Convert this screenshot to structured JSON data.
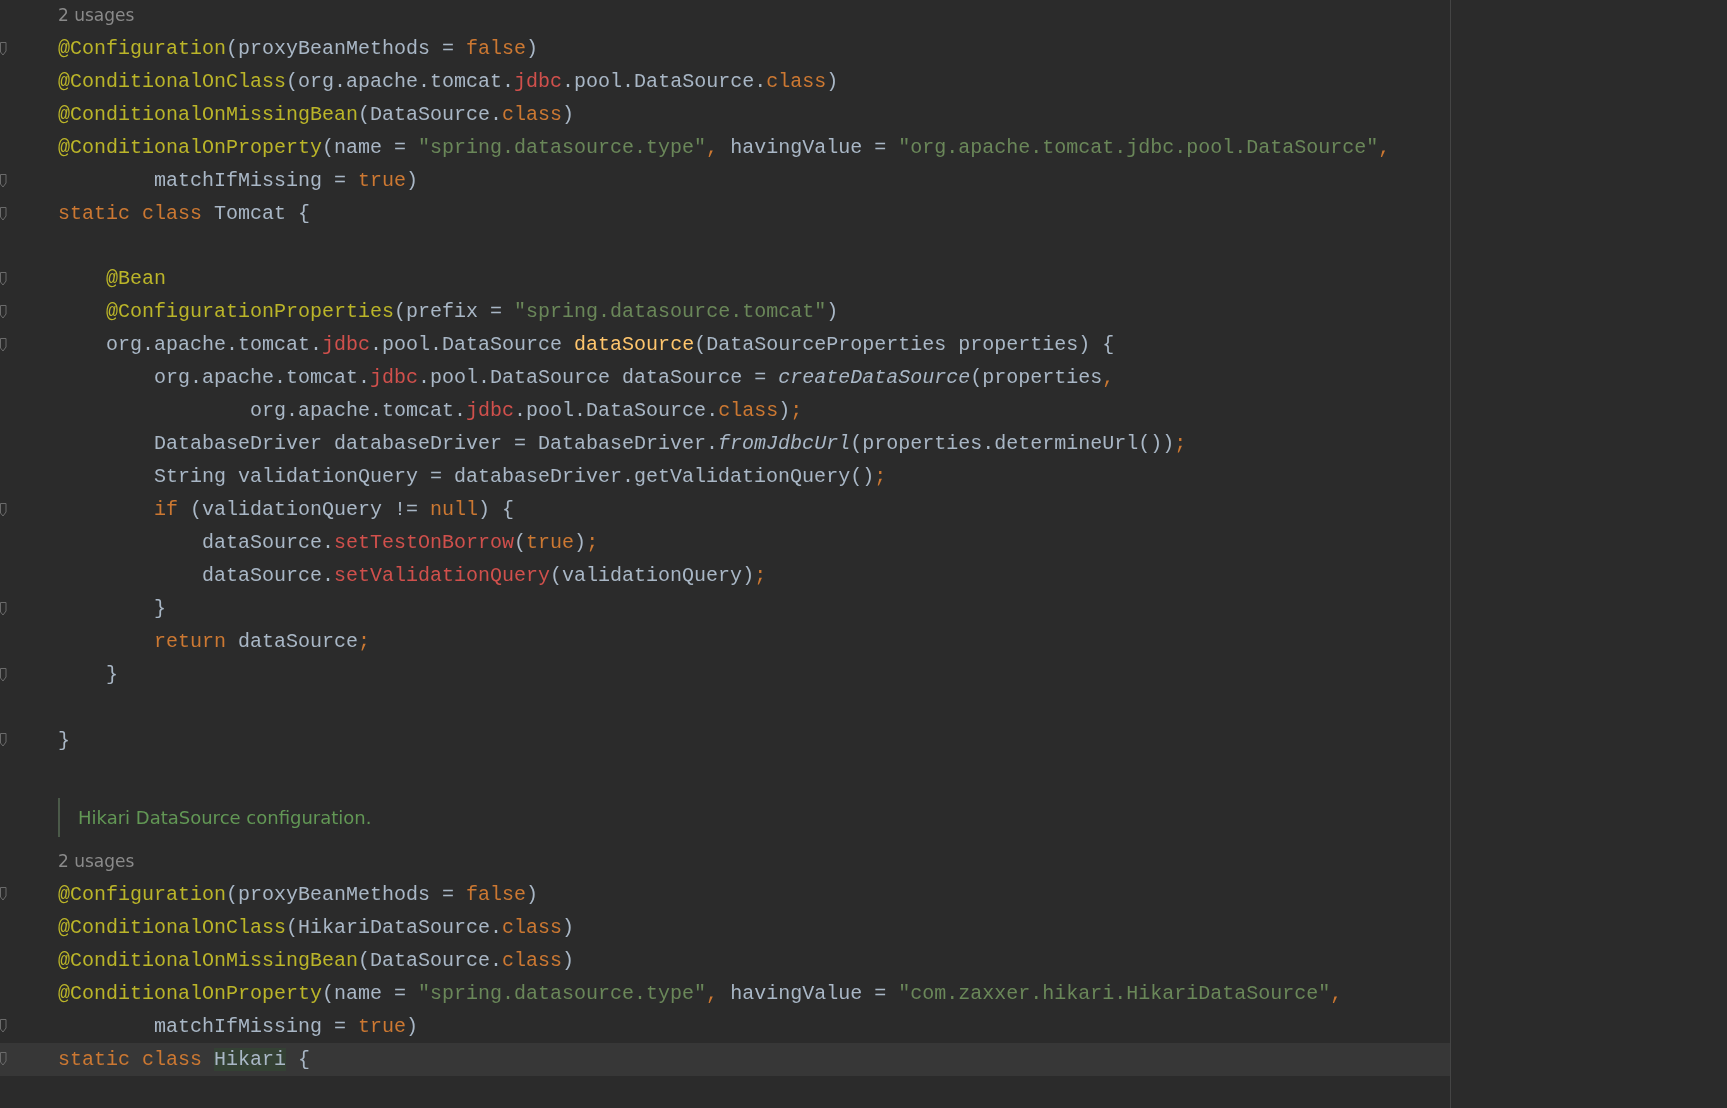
{
  "editor": {
    "lines": [
      {
        "kind": "usages",
        "text": "2 usages"
      },
      {
        "kind": "code",
        "fold": true,
        "current": false,
        "tokens": [
          {
            "t": "@Configuration",
            "kind": "annotation"
          },
          {
            "t": "(proxyBeanMethods = ",
            "kind": "plain"
          },
          {
            "t": "false",
            "kind": "keyword"
          },
          {
            "t": ")",
            "kind": "plain"
          }
        ]
      },
      {
        "kind": "code",
        "fold": false,
        "current": false,
        "tokens": [
          {
            "t": "@ConditionalOnClass",
            "kind": "annotation"
          },
          {
            "t": "(org.apache.tomcat.",
            "kind": "plain"
          },
          {
            "t": "jdbc",
            "kind": "error"
          },
          {
            "t": ".pool.DataSource.",
            "kind": "plain"
          },
          {
            "t": "class",
            "kind": "keyword"
          },
          {
            "t": ")",
            "kind": "plain"
          }
        ]
      },
      {
        "kind": "code",
        "fold": false,
        "current": false,
        "tokens": [
          {
            "t": "@ConditionalOnMissingBean",
            "kind": "annotation"
          },
          {
            "t": "(DataSource.",
            "kind": "plain"
          },
          {
            "t": "class",
            "kind": "keyword"
          },
          {
            "t": ")",
            "kind": "plain"
          }
        ]
      },
      {
        "kind": "code",
        "fold": false,
        "current": false,
        "tokens": [
          {
            "t": "@ConditionalOnProperty",
            "kind": "annotation"
          },
          {
            "t": "(name = ",
            "kind": "plain"
          },
          {
            "t": "\"spring.datasource.type\"",
            "kind": "string"
          },
          {
            "t": ", ",
            "kind": "keyword"
          },
          {
            "t": "havingValue = ",
            "kind": "plain"
          },
          {
            "t": "\"org.apache.tomcat.jdbc.pool.DataSource\"",
            "kind": "string"
          },
          {
            "t": ",",
            "kind": "keyword"
          }
        ]
      },
      {
        "kind": "code",
        "fold": true,
        "current": false,
        "tokens": [
          {
            "t": "        matchIfMissing = ",
            "kind": "plain"
          },
          {
            "t": "true",
            "kind": "keyword"
          },
          {
            "t": ")",
            "kind": "plain"
          }
        ]
      },
      {
        "kind": "code",
        "fold": true,
        "current": false,
        "tokens": [
          {
            "t": "static class ",
            "kind": "keyword"
          },
          {
            "t": "Tomcat {",
            "kind": "plain"
          }
        ]
      },
      {
        "kind": "blank"
      },
      {
        "kind": "code",
        "fold": true,
        "current": false,
        "tokens": [
          {
            "t": "    @Bean",
            "kind": "annotation"
          }
        ]
      },
      {
        "kind": "code",
        "fold": true,
        "current": false,
        "tokens": [
          {
            "t": "    @ConfigurationProperties",
            "kind": "annotation"
          },
          {
            "t": "(prefix = ",
            "kind": "plain"
          },
          {
            "t": "\"spring.datasource.tomcat\"",
            "kind": "string"
          },
          {
            "t": ")",
            "kind": "plain"
          }
        ]
      },
      {
        "kind": "code",
        "fold": true,
        "current": false,
        "tokens": [
          {
            "t": "    org.apache.tomcat.",
            "kind": "plain"
          },
          {
            "t": "jdbc",
            "kind": "error"
          },
          {
            "t": ".pool.DataSource ",
            "kind": "plain"
          },
          {
            "t": "dataSource",
            "kind": "method"
          },
          {
            "t": "(DataSourceProperties properties) {",
            "kind": "plain"
          }
        ]
      },
      {
        "kind": "code",
        "fold": false,
        "current": false,
        "tokens": [
          {
            "t": "        org.apache.tomcat.",
            "kind": "plain"
          },
          {
            "t": "jdbc",
            "kind": "error"
          },
          {
            "t": ".pool.DataSource dataSource = ",
            "kind": "plain"
          },
          {
            "t": "createDataSource",
            "kind": "static"
          },
          {
            "t": "(properties",
            "kind": "plain"
          },
          {
            "t": ",",
            "kind": "keyword"
          }
        ]
      },
      {
        "kind": "code",
        "fold": false,
        "current": false,
        "tokens": [
          {
            "t": "                org.apache.tomcat.",
            "kind": "plain"
          },
          {
            "t": "jdbc",
            "kind": "error"
          },
          {
            "t": ".pool.DataSource.",
            "kind": "plain"
          },
          {
            "t": "class",
            "kind": "keyword"
          },
          {
            "t": ")",
            "kind": "plain"
          },
          {
            "t": ";",
            "kind": "keyword"
          }
        ]
      },
      {
        "kind": "code",
        "fold": false,
        "current": false,
        "tokens": [
          {
            "t": "        DatabaseDriver databaseDriver = DatabaseDriver.",
            "kind": "plain"
          },
          {
            "t": "fromJdbcUrl",
            "kind": "static"
          },
          {
            "t": "(properties.determineUrl())",
            "kind": "plain"
          },
          {
            "t": ";",
            "kind": "keyword"
          }
        ]
      },
      {
        "kind": "code",
        "fold": false,
        "current": false,
        "tokens": [
          {
            "t": "        String validationQuery = databaseDriver.getValidationQuery()",
            "kind": "plain"
          },
          {
            "t": ";",
            "kind": "keyword"
          }
        ]
      },
      {
        "kind": "code",
        "fold": true,
        "current": false,
        "tokens": [
          {
            "t": "        if",
            "kind": "keyword"
          },
          {
            "t": " (validationQuery != ",
            "kind": "plain"
          },
          {
            "t": "null",
            "kind": "keyword"
          },
          {
            "t": ") {",
            "kind": "plain"
          }
        ]
      },
      {
        "kind": "code",
        "fold": false,
        "current": false,
        "tokens": [
          {
            "t": "            dataSource.",
            "kind": "plain"
          },
          {
            "t": "setTestOnBorrow",
            "kind": "error"
          },
          {
            "t": "(",
            "kind": "plain"
          },
          {
            "t": "true",
            "kind": "keyword"
          },
          {
            "t": ")",
            "kind": "plain"
          },
          {
            "t": ";",
            "kind": "keyword"
          }
        ]
      },
      {
        "kind": "code",
        "fold": false,
        "current": false,
        "tokens": [
          {
            "t": "            dataSource.",
            "kind": "plain"
          },
          {
            "t": "setValidationQuery",
            "kind": "error"
          },
          {
            "t": "(validationQuery)",
            "kind": "plain"
          },
          {
            "t": ";",
            "kind": "keyword"
          }
        ]
      },
      {
        "kind": "code",
        "fold": true,
        "current": false,
        "tokens": [
          {
            "t": "        }",
            "kind": "plain"
          }
        ]
      },
      {
        "kind": "code",
        "fold": false,
        "current": false,
        "tokens": [
          {
            "t": "        return",
            "kind": "keyword"
          },
          {
            "t": " dataSource",
            "kind": "plain"
          },
          {
            "t": ";",
            "kind": "keyword"
          }
        ]
      },
      {
        "kind": "code",
        "fold": true,
        "current": false,
        "tokens": [
          {
            "t": "    }",
            "kind": "plain"
          }
        ]
      },
      {
        "kind": "blank"
      },
      {
        "kind": "code",
        "fold": true,
        "current": false,
        "tokens": [
          {
            "t": "}",
            "kind": "plain"
          }
        ]
      },
      {
        "kind": "blank"
      },
      {
        "kind": "doc",
        "text": "Hikari DataSource configuration."
      },
      {
        "kind": "usages",
        "text": "2 usages"
      },
      {
        "kind": "code",
        "fold": true,
        "current": false,
        "tokens": [
          {
            "t": "@Configuration",
            "kind": "annotation"
          },
          {
            "t": "(proxyBeanMethods = ",
            "kind": "plain"
          },
          {
            "t": "false",
            "kind": "keyword"
          },
          {
            "t": ")",
            "kind": "plain"
          }
        ]
      },
      {
        "kind": "code",
        "fold": false,
        "current": false,
        "tokens": [
          {
            "t": "@ConditionalOnClass",
            "kind": "annotation"
          },
          {
            "t": "(HikariDataSource.",
            "kind": "plain"
          },
          {
            "t": "class",
            "kind": "keyword"
          },
          {
            "t": ")",
            "kind": "plain"
          }
        ]
      },
      {
        "kind": "code",
        "fold": false,
        "current": false,
        "tokens": [
          {
            "t": "@ConditionalOnMissingBean",
            "kind": "annotation"
          },
          {
            "t": "(DataSource.",
            "kind": "plain"
          },
          {
            "t": "class",
            "kind": "keyword"
          },
          {
            "t": ")",
            "kind": "plain"
          }
        ]
      },
      {
        "kind": "code",
        "fold": false,
        "current": false,
        "tokens": [
          {
            "t": "@ConditionalOnProperty",
            "kind": "annotation"
          },
          {
            "t": "(name = ",
            "kind": "plain"
          },
          {
            "t": "\"spring.datasource.type\"",
            "kind": "string"
          },
          {
            "t": ", ",
            "kind": "keyword"
          },
          {
            "t": "havingValue = ",
            "kind": "plain"
          },
          {
            "t": "\"com.zaxxer.hikari.HikariDataSource\"",
            "kind": "string"
          },
          {
            "t": ",",
            "kind": "keyword"
          }
        ]
      },
      {
        "kind": "code",
        "fold": true,
        "current": false,
        "tokens": [
          {
            "t": "        matchIfMissing = ",
            "kind": "plain"
          },
          {
            "t": "true",
            "kind": "keyword"
          },
          {
            "t": ")",
            "kind": "plain"
          }
        ]
      },
      {
        "kind": "code",
        "fold": true,
        "current": true,
        "tokens": [
          {
            "t": "static class ",
            "kind": "keyword"
          },
          {
            "t": "Hikari",
            "kind": "match"
          },
          {
            "t": " {",
            "kind": "plain"
          }
        ]
      },
      {
        "kind": "blank"
      }
    ]
  }
}
